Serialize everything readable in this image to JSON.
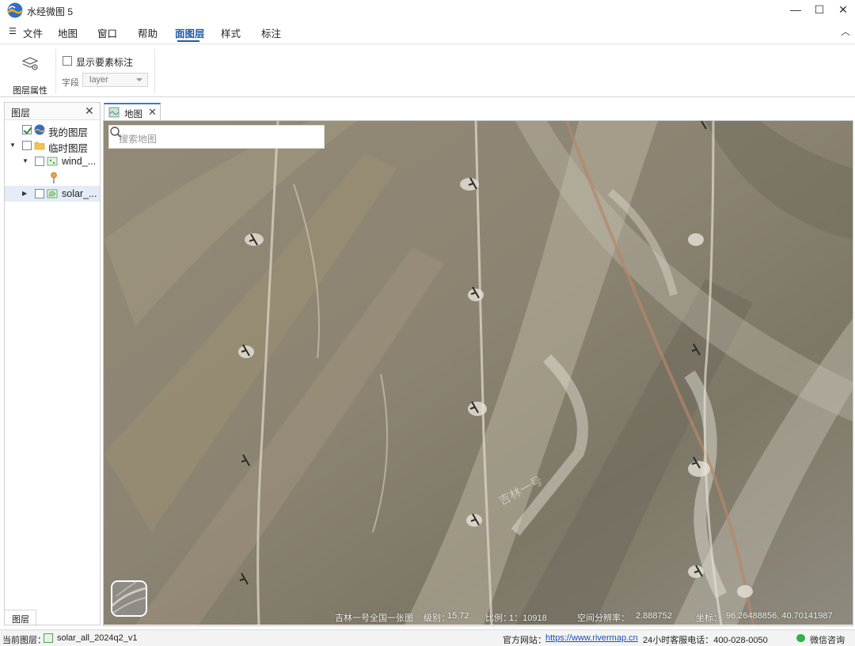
{
  "app": {
    "title": "水经微图 5"
  },
  "window_controls": {
    "minimize": "—",
    "maximize": "☐",
    "close": "✕"
  },
  "menu": {
    "hamburger": "☰",
    "items": [
      {
        "label": "文件"
      },
      {
        "label": "地图"
      },
      {
        "label": "窗口"
      },
      {
        "label": "帮助"
      },
      {
        "label": "面图层",
        "active": true
      },
      {
        "label": "样式"
      },
      {
        "label": "标注"
      }
    ],
    "collapse": "︿"
  },
  "ribbon": {
    "layer_props_label": "图层属性",
    "show_labels_text": "显示要素标注",
    "show_labels_checked": false,
    "field_label": "字段",
    "field_value": "layer"
  },
  "layer_panel": {
    "title": "图层",
    "close": "✕",
    "footer_tab": "图层",
    "tree": [
      {
        "label": "我的图层",
        "checked": true,
        "icon": "basemap-icon"
      },
      {
        "label": "临时图层",
        "checked": false,
        "icon": "folder-icon",
        "expanded": true
      },
      {
        "label": "wind_...",
        "checked": false,
        "icon": "point-layer-icon",
        "expanded": true
      },
      {
        "label": "solar_...",
        "checked": false,
        "icon": "polygon-layer-icon",
        "selected": true
      }
    ]
  },
  "map_tab": {
    "label": "地图",
    "close": "✕"
  },
  "map": {
    "search_placeholder": "搜索地图",
    "watermark": "吉林一号",
    "status": {
      "source": "吉林一号全国一张图",
      "level_label": "级别：",
      "level": "15.72",
      "scale_label": "比例：",
      "scale": "1：10918",
      "resolution_label": "空间分辨率：",
      "resolution": "2.888752",
      "coord_label": "坐标：",
      "coord": "96.26488856, 40.70141987"
    }
  },
  "statusbar": {
    "current_layer_label": "当前图层：",
    "current_layer": "solar_all_2024q2_v1",
    "website_label": "官方网站：",
    "website": "https://www.rivermap.cn",
    "hotline": "24小时客服电话：400-028-0050",
    "wechat": "微信咨询"
  }
}
